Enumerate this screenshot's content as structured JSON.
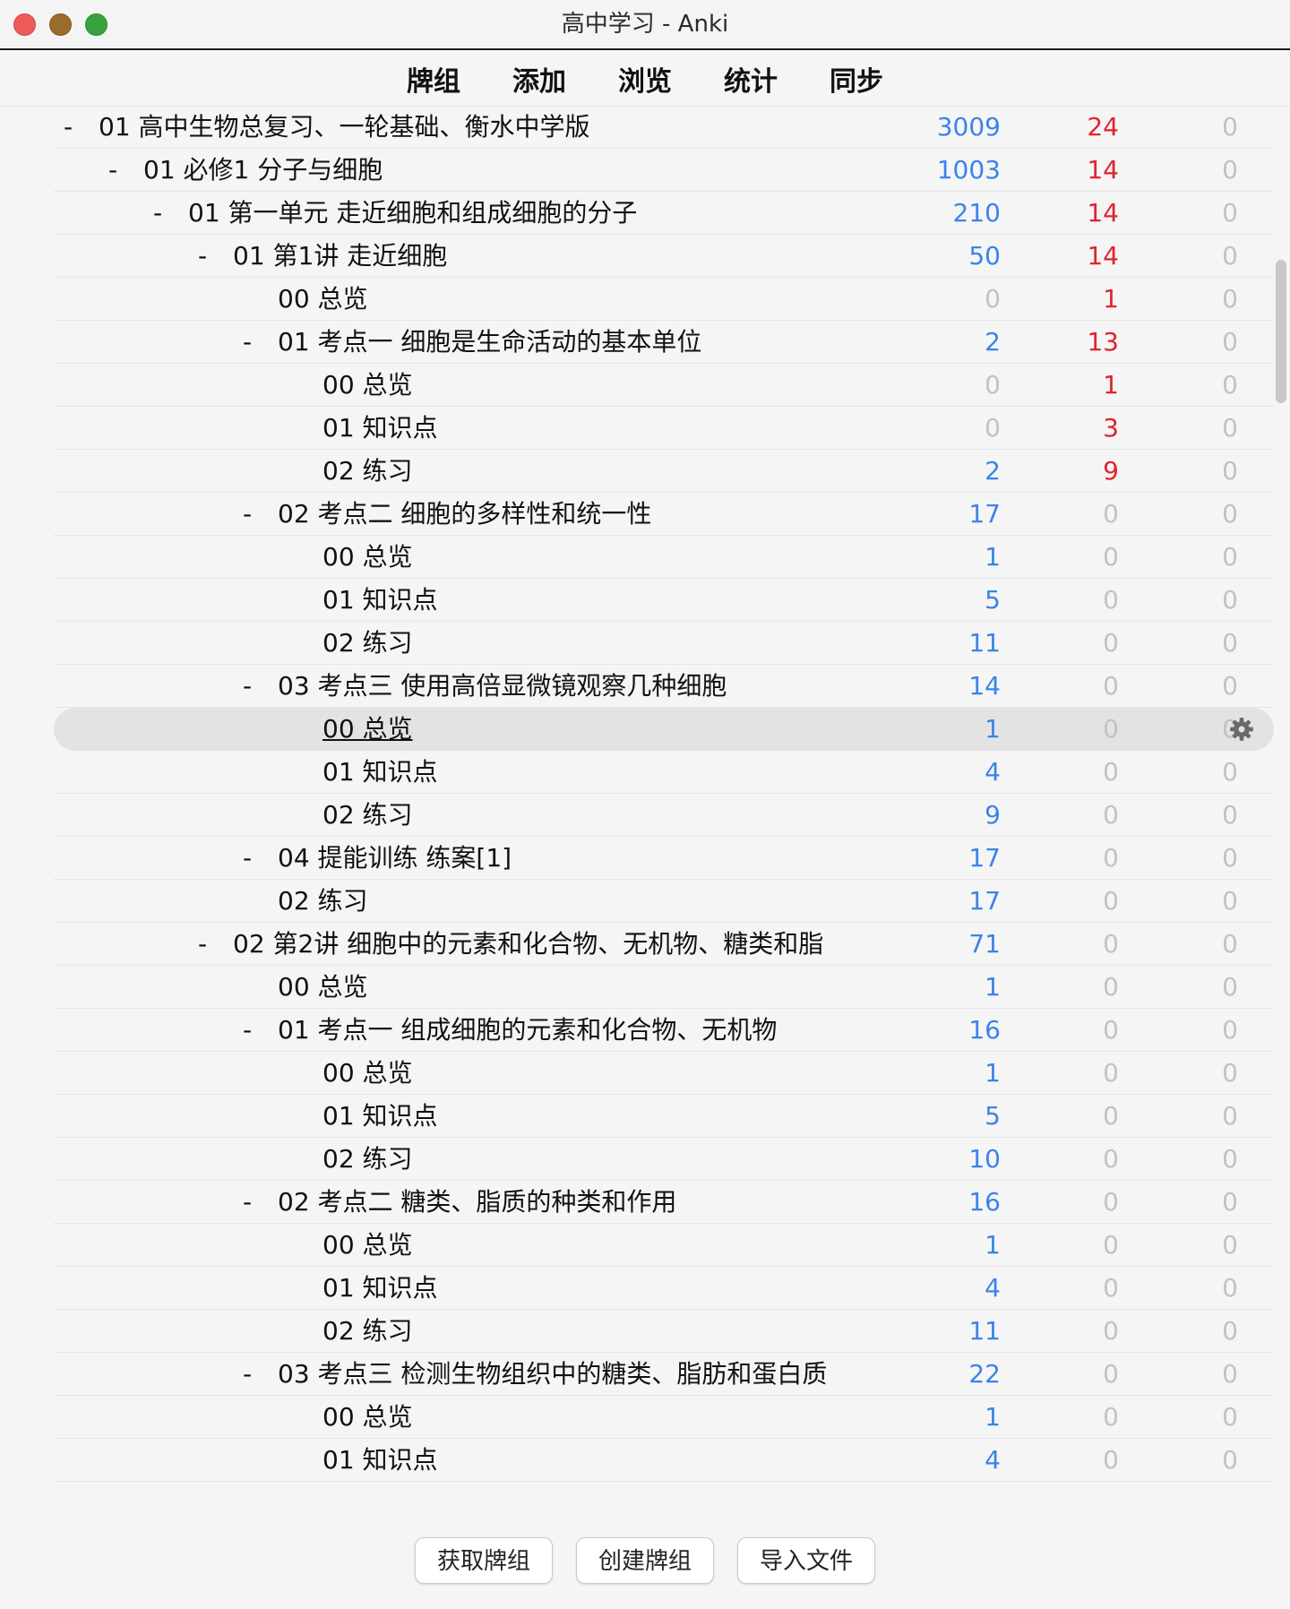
{
  "window": {
    "title": "高中学习 - Anki"
  },
  "toolbar": {
    "decks": "牌组",
    "add": "添加",
    "browse": "浏览",
    "stats": "统计",
    "sync": "同步"
  },
  "collapse_symbol": "-",
  "deck_rows": [
    {
      "name": "01 高中生物总复习、一轮基础、衡水中学版",
      "new": "3009",
      "learn": "24",
      "due": "0",
      "new_color": "blue",
      "learn_color": "red",
      "depth": 0,
      "expandable": true
    },
    {
      "name": "01 必修1 分子与细胞",
      "new": "1003",
      "learn": "14",
      "due": "0",
      "new_color": "blue",
      "learn_color": "red",
      "depth": 1,
      "expandable": true
    },
    {
      "name": "01 第一单元 走近细胞和组成细胞的分子",
      "new": "210",
      "learn": "14",
      "due": "0",
      "new_color": "blue",
      "learn_color": "red",
      "depth": 2,
      "expandable": true
    },
    {
      "name": "01 第1讲 走近细胞",
      "new": "50",
      "learn": "14",
      "due": "0",
      "new_color": "blue",
      "learn_color": "red",
      "depth": 3,
      "expandable": true
    },
    {
      "name": "00 总览",
      "new": "0",
      "learn": "1",
      "due": "0",
      "new_color": "gray",
      "learn_color": "red",
      "depth": 4,
      "expandable": false
    },
    {
      "name": "01 考点一 细胞是生命活动的基本单位",
      "new": "2",
      "learn": "13",
      "due": "0",
      "new_color": "blue",
      "learn_color": "red",
      "depth": 4,
      "expandable": true
    },
    {
      "name": "00 总览",
      "new": "0",
      "learn": "1",
      "due": "0",
      "new_color": "gray",
      "learn_color": "red",
      "depth": 5,
      "expandable": false
    },
    {
      "name": "01 知识点",
      "new": "0",
      "learn": "3",
      "due": "0",
      "new_color": "gray",
      "learn_color": "red",
      "depth": 5,
      "expandable": false
    },
    {
      "name": "02 练习",
      "new": "2",
      "learn": "9",
      "due": "0",
      "new_color": "blue",
      "learn_color": "red",
      "depth": 5,
      "expandable": false
    },
    {
      "name": "02 考点二 细胞的多样性和统一性",
      "new": "17",
      "learn": "0",
      "due": "0",
      "new_color": "blue",
      "learn_color": "gray",
      "depth": 4,
      "expandable": true
    },
    {
      "name": "00 总览",
      "new": "1",
      "learn": "0",
      "due": "0",
      "new_color": "blue",
      "learn_color": "gray",
      "depth": 5,
      "expandable": false
    },
    {
      "name": "01 知识点",
      "new": "5",
      "learn": "0",
      "due": "0",
      "new_color": "blue",
      "learn_color": "gray",
      "depth": 5,
      "expandable": false
    },
    {
      "name": "02 练习",
      "new": "11",
      "learn": "0",
      "due": "0",
      "new_color": "blue",
      "learn_color": "gray",
      "depth": 5,
      "expandable": false
    },
    {
      "name": "03 考点三 使用高倍显微镜观察几种细胞",
      "new": "14",
      "learn": "0",
      "due": "0",
      "new_color": "blue",
      "learn_color": "gray",
      "depth": 4,
      "expandable": true
    },
    {
      "name": "00 总览",
      "new": "1",
      "learn": "0",
      "due": "0",
      "new_color": "blue",
      "learn_color": "gray",
      "depth": 5,
      "expandable": false,
      "selected": true
    },
    {
      "name": "01 知识点",
      "new": "4",
      "learn": "0",
      "due": "0",
      "new_color": "blue",
      "learn_color": "gray",
      "depth": 5,
      "expandable": false
    },
    {
      "name": "02 练习",
      "new": "9",
      "learn": "0",
      "due": "0",
      "new_color": "blue",
      "learn_color": "gray",
      "depth": 5,
      "expandable": false
    },
    {
      "name": "04 提能训练 练案[1]",
      "new": "17",
      "learn": "0",
      "due": "0",
      "new_color": "blue",
      "learn_color": "gray",
      "depth": 4,
      "expandable": true
    },
    {
      "name": "02 练习",
      "new": "17",
      "learn": "0",
      "due": "0",
      "new_color": "blue",
      "learn_color": "gray",
      "depth": 4,
      "expandable": false
    },
    {
      "name": "02 第2讲 细胞中的元素和化合物、无机物、糖类和脂",
      "new": "71",
      "learn": "0",
      "due": "0",
      "new_color": "blue",
      "learn_color": "gray",
      "depth": 3,
      "expandable": true
    },
    {
      "name": "00 总览",
      "new": "1",
      "learn": "0",
      "due": "0",
      "new_color": "blue",
      "learn_color": "gray",
      "depth": 4,
      "expandable": false
    },
    {
      "name": "01 考点一 组成细胞的元素和化合物、无机物",
      "new": "16",
      "learn": "0",
      "due": "0",
      "new_color": "blue",
      "learn_color": "gray",
      "depth": 4,
      "expandable": true
    },
    {
      "name": "00 总览",
      "new": "1",
      "learn": "0",
      "due": "0",
      "new_color": "blue",
      "learn_color": "gray",
      "depth": 5,
      "expandable": false
    },
    {
      "name": "01 知识点",
      "new": "5",
      "learn": "0",
      "due": "0",
      "new_color": "blue",
      "learn_color": "gray",
      "depth": 5,
      "expandable": false
    },
    {
      "name": "02 练习",
      "new": "10",
      "learn": "0",
      "due": "0",
      "new_color": "blue",
      "learn_color": "gray",
      "depth": 5,
      "expandable": false
    },
    {
      "name": "02 考点二 糖类、脂质的种类和作用",
      "new": "16",
      "learn": "0",
      "due": "0",
      "new_color": "blue",
      "learn_color": "gray",
      "depth": 4,
      "expandable": true
    },
    {
      "name": "00 总览",
      "new": "1",
      "learn": "0",
      "due": "0",
      "new_color": "blue",
      "learn_color": "gray",
      "depth": 5,
      "expandable": false
    },
    {
      "name": "01 知识点",
      "new": "4",
      "learn": "0",
      "due": "0",
      "new_color": "blue",
      "learn_color": "gray",
      "depth": 5,
      "expandable": false
    },
    {
      "name": "02 练习",
      "new": "11",
      "learn": "0",
      "due": "0",
      "new_color": "blue",
      "learn_color": "gray",
      "depth": 5,
      "expandable": false
    },
    {
      "name": "03 考点三 检测生物组织中的糖类、脂肪和蛋白质",
      "new": "22",
      "learn": "0",
      "due": "0",
      "new_color": "blue",
      "learn_color": "gray",
      "depth": 4,
      "expandable": true
    },
    {
      "name": "00 总览",
      "new": "1",
      "learn": "0",
      "due": "0",
      "new_color": "blue",
      "learn_color": "gray",
      "depth": 5,
      "expandable": false
    },
    {
      "name": "01 知识点",
      "new": "4",
      "learn": "0",
      "due": "0",
      "new_color": "blue",
      "learn_color": "gray",
      "depth": 5,
      "expandable": false
    }
  ],
  "gear_icon": "gear-icon",
  "bottom_buttons": {
    "get_shared": "获取牌组",
    "create_deck": "创建牌组",
    "import_file": "导入文件"
  },
  "colors": {
    "new_count": "#3c83e8",
    "learn_count": "#e0232e",
    "zero_count": "#c2c2c2",
    "selected_row": "#e3e3e3"
  }
}
